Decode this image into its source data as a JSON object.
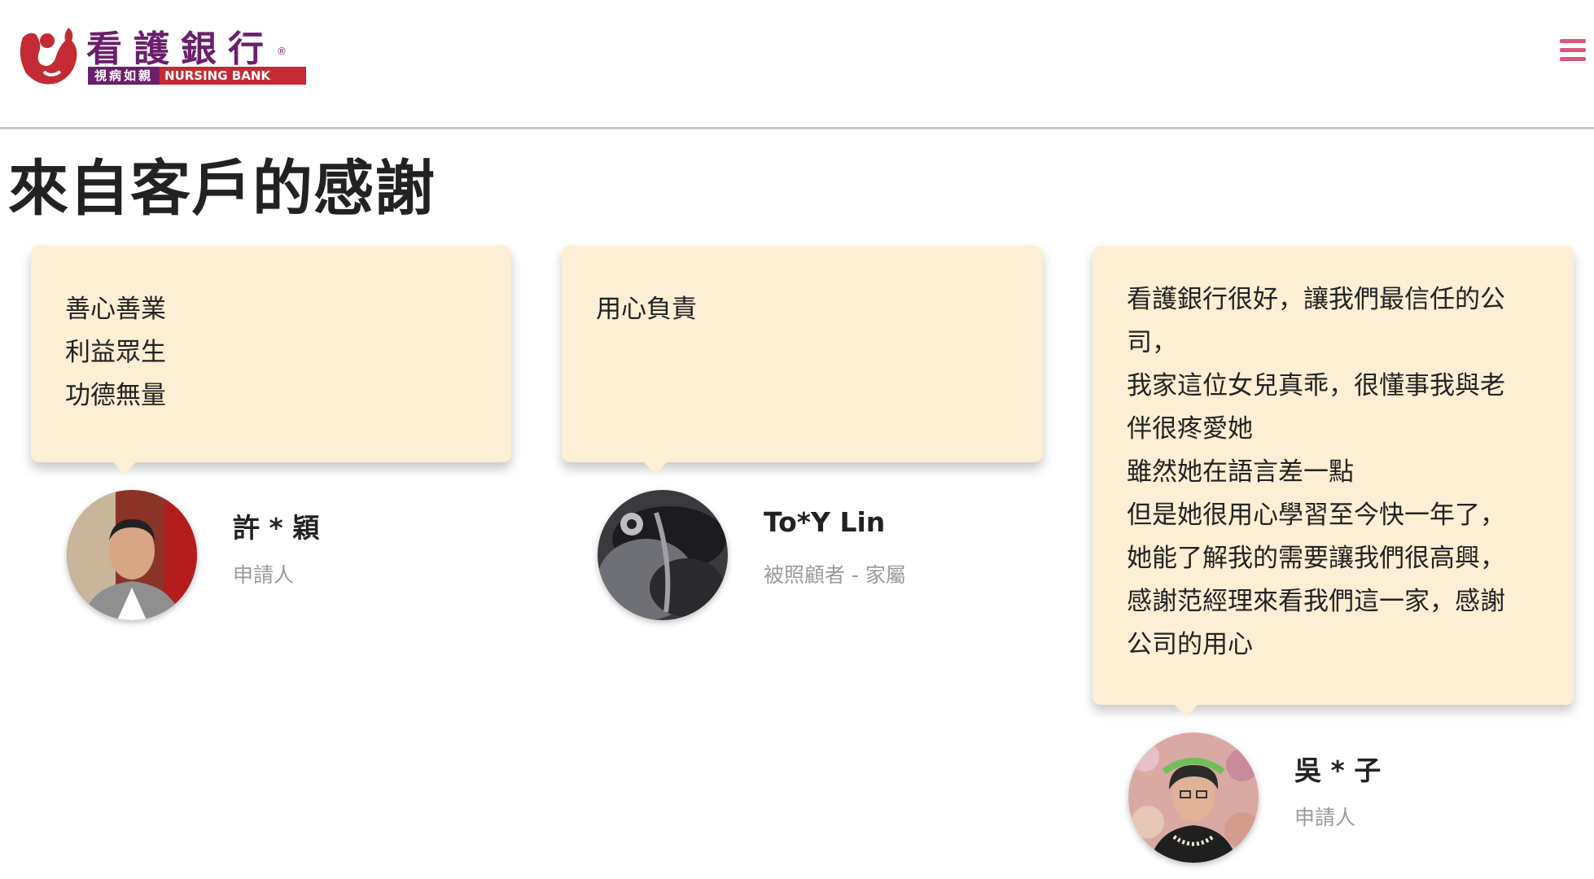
{
  "header": {
    "logo": {
      "title": "看護銀行",
      "registered": "®",
      "tagline_cn": "視病如親",
      "tagline_en": "NURSING BANK"
    },
    "menu_icon": "hamburger-menu-icon"
  },
  "page_title": "來自客戶的感謝",
  "colors": {
    "brand_purple": "#6b1f6b",
    "brand_red": "#c42a33",
    "menu_pink": "#d8577b",
    "bubble_bg": "#fdefd3"
  },
  "testimonials": [
    {
      "lines": [
        "善心善業",
        "利益眾生",
        "功德無量"
      ],
      "name": "許 * 穎",
      "role": "申請人"
    },
    {
      "lines": [
        "用心負責"
      ],
      "name": "To*Y Lin",
      "role": "被照顧者 - 家屬"
    },
    {
      "lines": [
        "看護銀行很好，讓我們最信任的公",
        "司，",
        "我家這位女兒真乖，很懂事我與老",
        "伴很疼愛她",
        "雖然她在語言差一點",
        "但是她很用心學習至今快一年了，",
        "她能了解我的需要讓我們很高興，",
        "感謝范經理來看我們這一家，感謝",
        "公司的用心"
      ],
      "name": "吳 * 子",
      "role": "申請人"
    }
  ]
}
